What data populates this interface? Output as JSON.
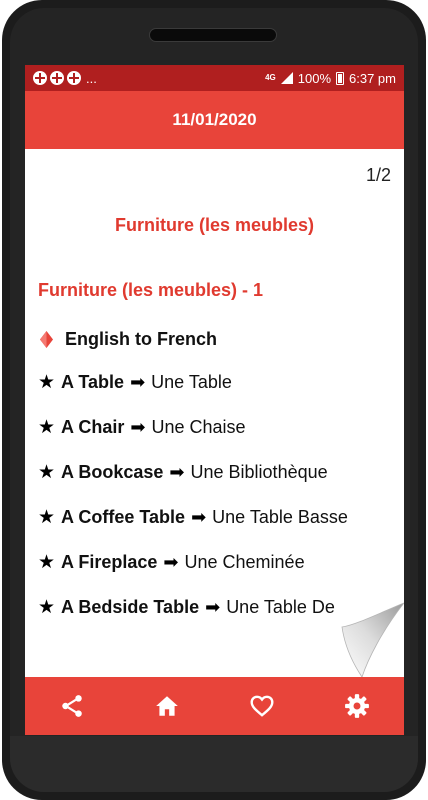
{
  "status_bar": {
    "notification_icons": [
      "app-notification-icon",
      "app-notification-icon",
      "app-notification-icon"
    ],
    "overflow": "...",
    "network": "4G",
    "battery": "100%",
    "time": "6:37 pm"
  },
  "app_bar": {
    "title": "11/01/2020"
  },
  "content": {
    "page_indicator": "1/2",
    "section_title": "Furniture (les meubles)",
    "lesson_title": "Furniture (les meubles) - 1",
    "direction_label": "English to French",
    "items": [
      {
        "english": "A Table",
        "french": "Une Table"
      },
      {
        "english": "A Chair",
        "french": "Une Chaise"
      },
      {
        "english": "A Bookcase",
        "french": "Une Bibliothèque"
      },
      {
        "english": "A Coffee Table",
        "french": "Une Table Basse"
      },
      {
        "english": "A Fireplace",
        "french": "Une Cheminée"
      },
      {
        "english": "A Bedside Table",
        "french": "Une Table De"
      }
    ]
  },
  "bottom_nav": {
    "icons": [
      "share-icon",
      "home-icon",
      "heart-icon",
      "settings-icon"
    ]
  },
  "colors": {
    "primary": "#e8443a",
    "status_bar": "#b01f1f",
    "accent_text": "#e03a2f"
  }
}
